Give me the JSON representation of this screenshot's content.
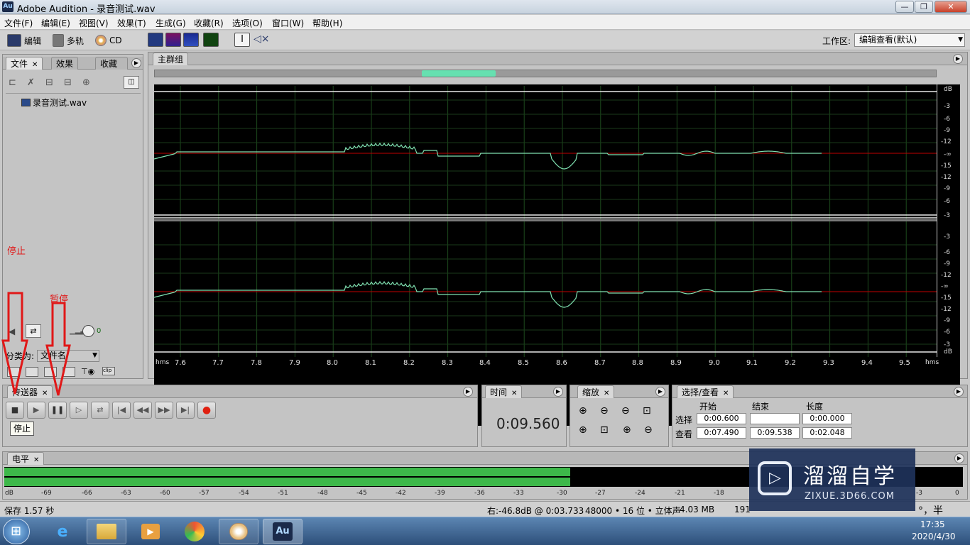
{
  "window": {
    "title": "Adobe Audition - 录音测试.wav",
    "app_icon": "Au",
    "buttons": [
      "—",
      "❐",
      "✕"
    ]
  },
  "menu": [
    "文件(F)",
    "编辑(E)",
    "视图(V)",
    "效果(T)",
    "生成(G)",
    "收藏(R)",
    "选项(O)",
    "窗口(W)",
    "帮助(H)"
  ],
  "toolbar": {
    "edit_label": "编辑",
    "multitrack_label": "多轨",
    "cd_label": "CD",
    "workspace_label": "工作区:",
    "workspace_value": "编辑查看(默认)"
  },
  "files_panel": {
    "tabs": [
      "文件",
      "效果",
      "收藏夹"
    ],
    "file_item": "录音测试.wav",
    "sort_label": "分类为:",
    "sort_value": "文件名",
    "volume_value": "0"
  },
  "main_group": {
    "tab": "主群组",
    "db_scale_top": [
      "dB",
      "-3",
      "-6",
      "-9",
      "-12",
      "-∞",
      "-15",
      "-12",
      "-9",
      "-6",
      "-3",
      "dB"
    ],
    "db_scale_bottom": [
      "-3",
      "-6",
      "-9",
      "-12",
      "-∞",
      "-15",
      "-12",
      "-9",
      "-6",
      "-3",
      "dB"
    ],
    "ruler_unit": "hms",
    "ruler_ticks": [
      "7.6",
      "7.7",
      "7.8",
      "7.9",
      "8.0",
      "8.1",
      "8.2",
      "8.3",
      "8.4",
      "8.5",
      "8.6",
      "8.7",
      "8.8",
      "8.9",
      "9.0",
      "9.1",
      "9.2",
      "9.3",
      "9.4",
      "9.5"
    ],
    "ruler_unit_end": "hms"
  },
  "transport": {
    "tab": "传送器",
    "tooltip": "停止"
  },
  "time_panel": {
    "tab": "时间",
    "value": "0:09.560"
  },
  "zoom_panel": {
    "tab": "缩放"
  },
  "selection_panel": {
    "tab": "选择/查看",
    "headers": [
      "开始",
      "结束",
      "长度"
    ],
    "rows": [
      {
        "label": "选择",
        "start": "0:00.600",
        "end": "",
        "length": "0:00.000"
      },
      {
        "label": "查看",
        "start": "0:07.490",
        "end": "0:09.538",
        "length": "0:02.048"
      }
    ]
  },
  "level_panel": {
    "tab": "电平",
    "fill_fraction": 0.59,
    "scale": [
      "dB",
      "-69",
      "-66",
      "-63",
      "-60",
      "-57",
      "-54",
      "-51",
      "-48",
      "-45",
      "-42",
      "-39",
      "-36",
      "-33",
      "-30",
      "-27",
      "-24",
      "-21",
      "-18",
      "-3",
      "0"
    ]
  },
  "status_bar": {
    "left": "保存 1.57 秒",
    "right_level": "右:-46.8dB @  0:03.733",
    "format": "48000 • 16 位 • 立体声",
    "size": "4.03 MB",
    "trail": "191",
    "ime_text": "°，半"
  },
  "annotations": {
    "stop": "停止",
    "pause": "暂停",
    "color": "#e01818"
  },
  "watermark": {
    "title": "溜溜自学",
    "url": "ZIXUE.3D66.COM"
  },
  "taskbar": {
    "time": "17:35",
    "date": "2020/4/30",
    "au_label": "Au"
  },
  "colors": {
    "waveform": "#7fe0b0",
    "center_line": "#c00000",
    "level_fill": "#3db84a",
    "scroll_thumb": "#66e0b0"
  }
}
